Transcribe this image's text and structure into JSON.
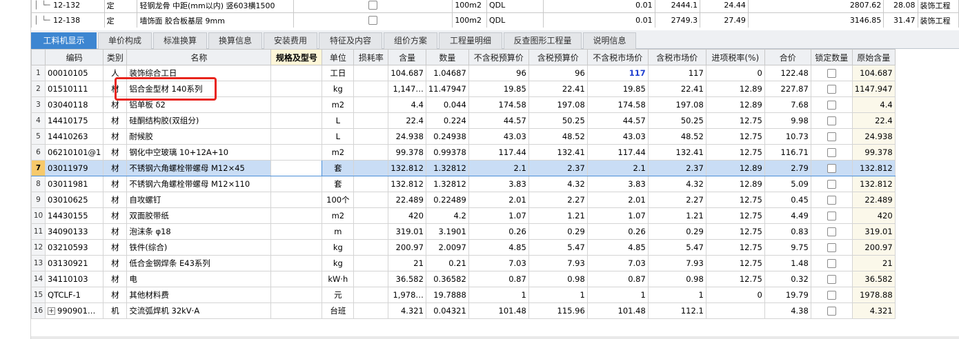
{
  "top_rows": [
    {
      "code": "12-132",
      "type": "定",
      "name": "轻钢龙骨 中距(mm以内) 竖603横1500",
      "unit": "100m2",
      "prog": "QDL",
      "qty": "0.01",
      "p1": "2444.1",
      "p2": "24.44",
      "p3": "2807.62",
      "p4": "28.08",
      "cat": "装饰工程"
    },
    {
      "code": "12-138",
      "type": "定",
      "name": "墙饰面 胶合板基层 9mm",
      "unit": "100m2",
      "prog": "QDL",
      "qty": "0.01",
      "p1": "2749.3",
      "p2": "27.49",
      "p3": "3146.85",
      "p4": "31.47",
      "cat": "装饰工程"
    }
  ],
  "tabs": [
    "工料机显示",
    "单价构成",
    "标准换算",
    "换算信息",
    "安装费用",
    "特征及内容",
    "组价方案",
    "工程量明细",
    "反查图形工程量",
    "说明信息"
  ],
  "active_tab": "工料机显示",
  "columns": [
    "编码",
    "类别",
    "名称",
    "规格及型号",
    "单位",
    "损耗率",
    "含量",
    "数量",
    "不含税预算价",
    "含税预算价",
    "不含税市场价",
    "含税市场价",
    "进项税率(%)",
    "合价",
    "锁定数量",
    "原始含量"
  ],
  "rows": [
    {
      "no": "1",
      "code": "00010105",
      "cat": "人",
      "name": "装饰综合工日",
      "spec": "",
      "unit": "工日",
      "loss": "",
      "content": "104.687",
      "qty": "1.04687",
      "bp_ex": "96",
      "bp_in": "96",
      "mp_ex": "117",
      "mp_in": "117",
      "tax": "0",
      "total": "122.48",
      "orig": "104.687"
    },
    {
      "no": "2",
      "code": "01510111",
      "cat": "材",
      "name": "铝合金型材 140系列",
      "spec": "",
      "unit": "kg",
      "loss": "",
      "content": "1,147…",
      "qty": "11.47947",
      "bp_ex": "19.85",
      "bp_in": "22.41",
      "mp_ex": "19.85",
      "mp_in": "22.41",
      "tax": "12.89",
      "total": "227.87",
      "orig": "1147.947"
    },
    {
      "no": "3",
      "code": "03040118",
      "cat": "材",
      "name": "铝单板 δ2",
      "spec": "",
      "unit": "m2",
      "loss": "",
      "content": "4.4",
      "qty": "0.044",
      "bp_ex": "174.58",
      "bp_in": "197.08",
      "mp_ex": "174.58",
      "mp_in": "197.08",
      "tax": "12.89",
      "total": "7.68",
      "orig": "4.4"
    },
    {
      "no": "4",
      "code": "14410175",
      "cat": "材",
      "name": "硅酮结构胶(双组分)",
      "spec": "",
      "unit": "L",
      "loss": "",
      "content": "22.4",
      "qty": "0.224",
      "bp_ex": "44.57",
      "bp_in": "50.25",
      "mp_ex": "44.57",
      "mp_in": "50.25",
      "tax": "12.75",
      "total": "9.98",
      "orig": "22.4"
    },
    {
      "no": "5",
      "code": "14410263",
      "cat": "材",
      "name": "耐候胶",
      "spec": "",
      "unit": "L",
      "loss": "",
      "content": "24.938",
      "qty": "0.24938",
      "bp_ex": "43.03",
      "bp_in": "48.52",
      "mp_ex": "43.03",
      "mp_in": "48.52",
      "tax": "12.75",
      "total": "10.73",
      "orig": "24.938"
    },
    {
      "no": "6",
      "code": "06210101@1",
      "cat": "材",
      "name": "钢化中空玻璃 10+12A+10",
      "spec": "",
      "unit": "m2",
      "loss": "",
      "content": "99.378",
      "qty": "0.99378",
      "bp_ex": "117.44",
      "bp_in": "132.41",
      "mp_ex": "117.44",
      "mp_in": "132.41",
      "tax": "12.75",
      "total": "116.71",
      "orig": "99.378"
    },
    {
      "no": "7",
      "code": "03011979",
      "cat": "材",
      "name": "不锈钢六角螺栓带螺母 M12×45",
      "spec": "",
      "unit": "套",
      "loss": "",
      "content": "132.812",
      "qty": "1.32812",
      "bp_ex": "2.1",
      "bp_in": "2.37",
      "mp_ex": "2.1",
      "mp_in": "2.37",
      "tax": "12.89",
      "total": "2.79",
      "orig": "132.812"
    },
    {
      "no": "8",
      "code": "03011981",
      "cat": "材",
      "name": "不锈钢六角螺栓带螺母 M12×110",
      "spec": "",
      "unit": "套",
      "loss": "",
      "content": "132.812",
      "qty": "1.32812",
      "bp_ex": "3.83",
      "bp_in": "4.32",
      "mp_ex": "3.83",
      "mp_in": "4.32",
      "tax": "12.89",
      "total": "5.09",
      "orig": "132.812"
    },
    {
      "no": "9",
      "code": "03010625",
      "cat": "材",
      "name": "自攻螺钉",
      "spec": "",
      "unit": "100个",
      "loss": "",
      "content": "22.489",
      "qty": "0.22489",
      "bp_ex": "2.01",
      "bp_in": "2.27",
      "mp_ex": "2.01",
      "mp_in": "2.27",
      "tax": "12.75",
      "total": "0.45",
      "orig": "22.489"
    },
    {
      "no": "10",
      "code": "14430155",
      "cat": "材",
      "name": "双面胶带纸",
      "spec": "",
      "unit": "m2",
      "loss": "",
      "content": "420",
      "qty": "4.2",
      "bp_ex": "1.07",
      "bp_in": "1.21",
      "mp_ex": "1.07",
      "mp_in": "1.21",
      "tax": "12.75",
      "total": "4.49",
      "orig": "420"
    },
    {
      "no": "11",
      "code": "34090133",
      "cat": "材",
      "name": "泡沫条 φ18",
      "spec": "",
      "unit": "m",
      "loss": "",
      "content": "319.01",
      "qty": "3.1901",
      "bp_ex": "0.26",
      "bp_in": "0.29",
      "mp_ex": "0.26",
      "mp_in": "0.29",
      "tax": "12.75",
      "total": "0.83",
      "orig": "319.01"
    },
    {
      "no": "12",
      "code": "03210593",
      "cat": "材",
      "name": "铁件(综合)",
      "spec": "",
      "unit": "kg",
      "loss": "",
      "content": "200.97",
      "qty": "2.0097",
      "bp_ex": "4.85",
      "bp_in": "5.47",
      "mp_ex": "4.85",
      "mp_in": "5.47",
      "tax": "12.75",
      "total": "9.75",
      "orig": "200.97"
    },
    {
      "no": "13",
      "code": "03130921",
      "cat": "材",
      "name": "低合金钢焊条 E43系列",
      "spec": "",
      "unit": "kg",
      "loss": "",
      "content": "21",
      "qty": "0.21",
      "bp_ex": "7.03",
      "bp_in": "7.93",
      "mp_ex": "7.03",
      "mp_in": "7.93",
      "tax": "12.75",
      "total": "1.48",
      "orig": "21"
    },
    {
      "no": "14",
      "code": "34110103",
      "cat": "材",
      "name": "电",
      "spec": "",
      "unit": "kW·h",
      "loss": "",
      "content": "36.582",
      "qty": "0.36582",
      "bp_ex": "0.87",
      "bp_in": "0.98",
      "mp_ex": "0.87",
      "mp_in": "0.98",
      "tax": "12.75",
      "total": "0.32",
      "orig": "36.582"
    },
    {
      "no": "15",
      "code": "QTCLF-1",
      "cat": "材",
      "name": "其他材料费",
      "spec": "",
      "unit": "元",
      "loss": "",
      "content": "1,978…",
      "qty": "19.7888",
      "bp_ex": "1",
      "bp_in": "1",
      "mp_ex": "1",
      "mp_in": "1",
      "tax": "0",
      "total": "19.79",
      "orig": "1978.88"
    },
    {
      "no": "16",
      "code": "990901…",
      "cat": "机",
      "name": "交流弧焊机 32kV·A",
      "spec": "",
      "unit": "台班",
      "loss": "",
      "content": "4.321",
      "qty": "0.04321",
      "bp_ex": "101.48",
      "bp_in": "115.96",
      "mp_ex": "101.48",
      "mp_in": "112.1",
      "tax": "",
      "total": "4.38",
      "orig": "4.321"
    }
  ],
  "selected_row": "7",
  "highlight_color": "#e8241c",
  "accent": "#3d86d1"
}
